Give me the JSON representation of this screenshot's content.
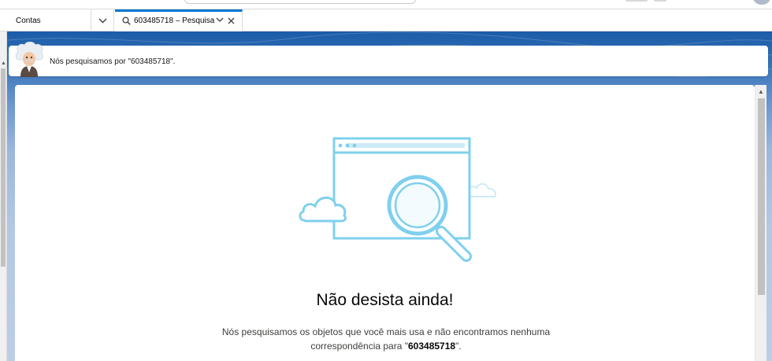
{
  "tabs": {
    "object_label": "Contas",
    "active_tab_label": "603485718 – Pesquisa"
  },
  "info_bar": {
    "message": "Nós pesquisamos por \"603485718\"."
  },
  "empty_state": {
    "heading": "Não desista ainda!",
    "description_prefix": "Nós pesquisamos os objetos que você mais usa e não encontramos nenhuma correspondência para \"",
    "search_term": "603485718",
    "description_suffix": "\"."
  },
  "icons": {
    "tab_dropdown": "chevron-down-icon",
    "tab_search": "search-icon",
    "tab_close": "close-icon",
    "mascot": "einstein-avatar",
    "illustration": "search-window-illustration"
  },
  "colors": {
    "brand_blue": "#0176d3",
    "banner_top": "#1b5ca8",
    "illustration_blue": "#7fd0ee"
  }
}
